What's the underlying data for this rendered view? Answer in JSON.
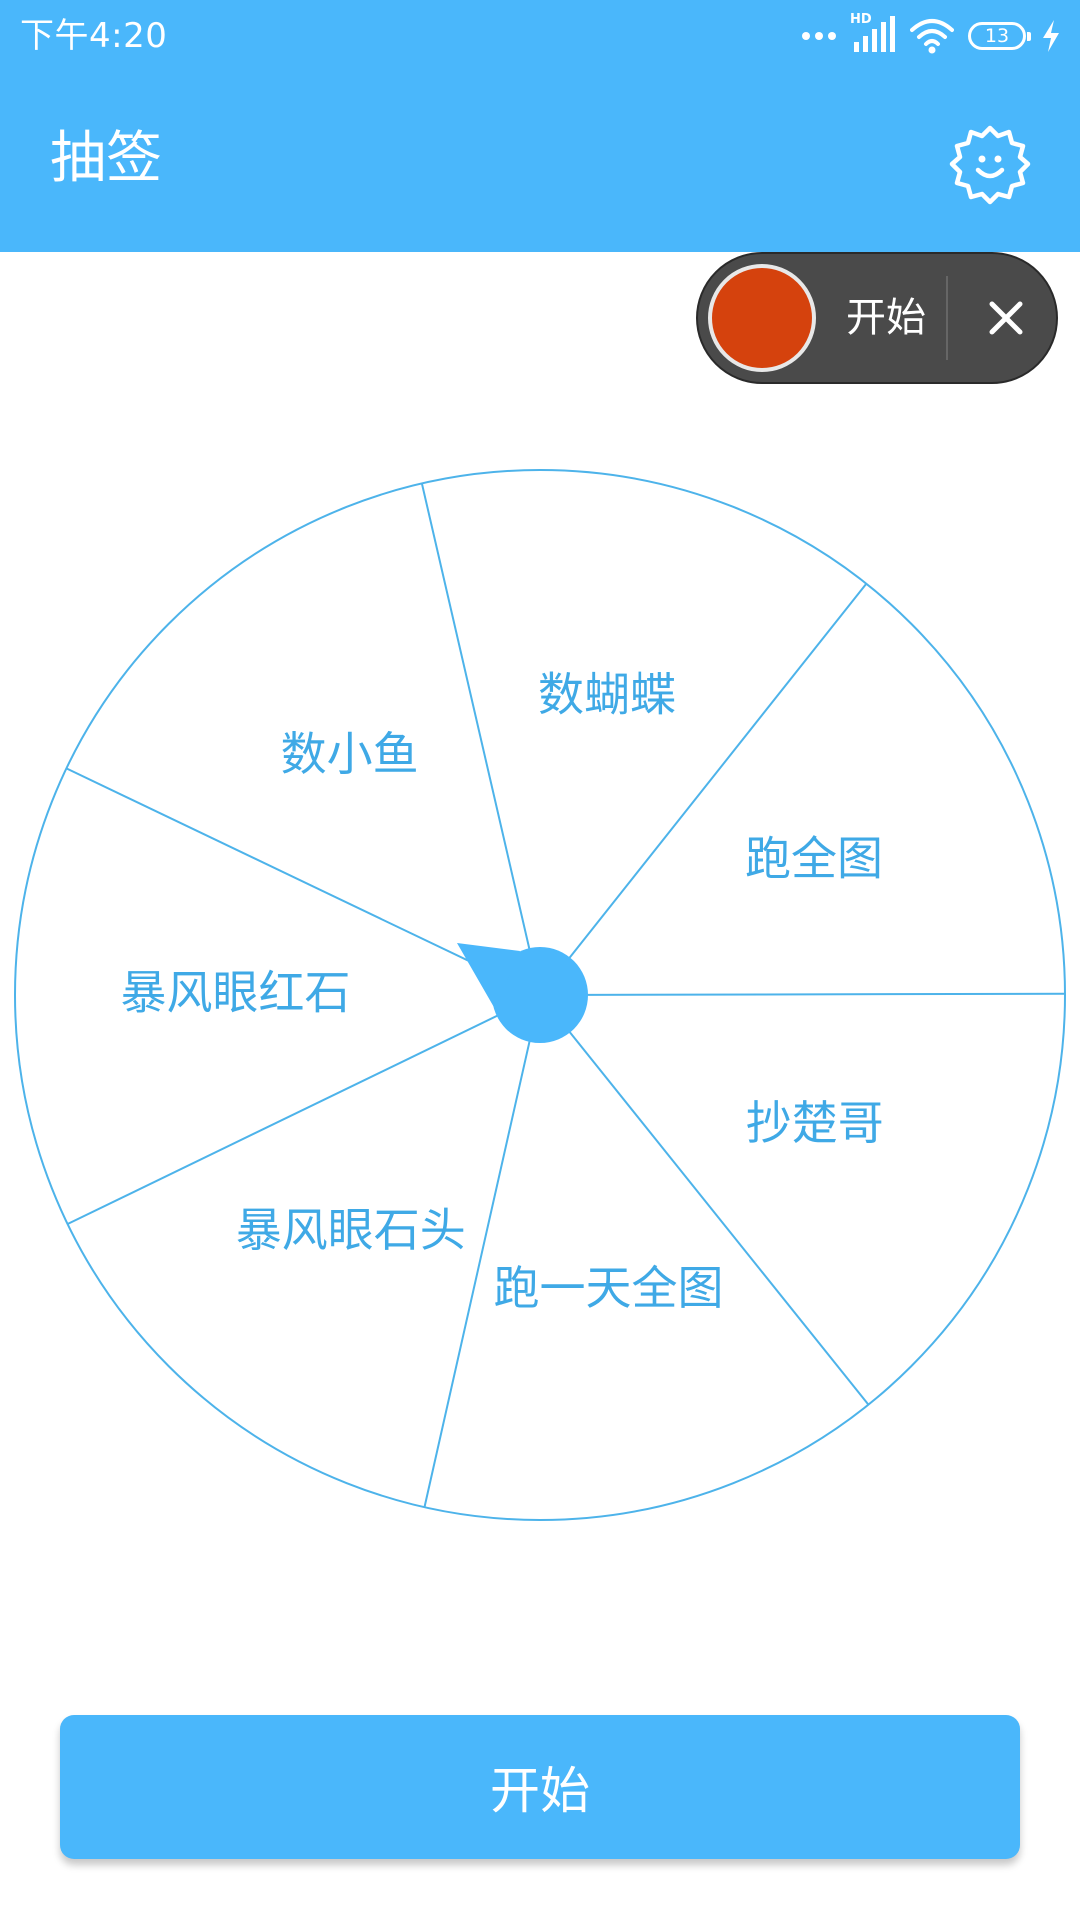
{
  "status_bar": {
    "time": "下午4:20",
    "battery_level": "13",
    "network_badge": "HD",
    "icons": [
      "more-dots-icon",
      "signal-icon",
      "wifi-icon",
      "battery-icon",
      "charging-icon"
    ]
  },
  "app_bar": {
    "title": "抽签",
    "settings_icon": "gear-smile-icon"
  },
  "recorder": {
    "start_label": "开始",
    "close_glyph": "✕"
  },
  "wheel": {
    "segments": [
      "数蝴蝶",
      "跑全图",
      "抄楚哥",
      "跑一天全图",
      "暴风眼石头",
      "暴风眼红石",
      "数小鱼"
    ],
    "pointer_icon": "pointer-icon"
  },
  "start_button": {
    "label": "开始"
  },
  "colors": {
    "primary": "#4ab7fb",
    "wheel_line": "#4db3ea",
    "wheel_text": "#3fa9e6",
    "record_red": "#d5420d",
    "pill_bg": "#4a4a4a"
  }
}
